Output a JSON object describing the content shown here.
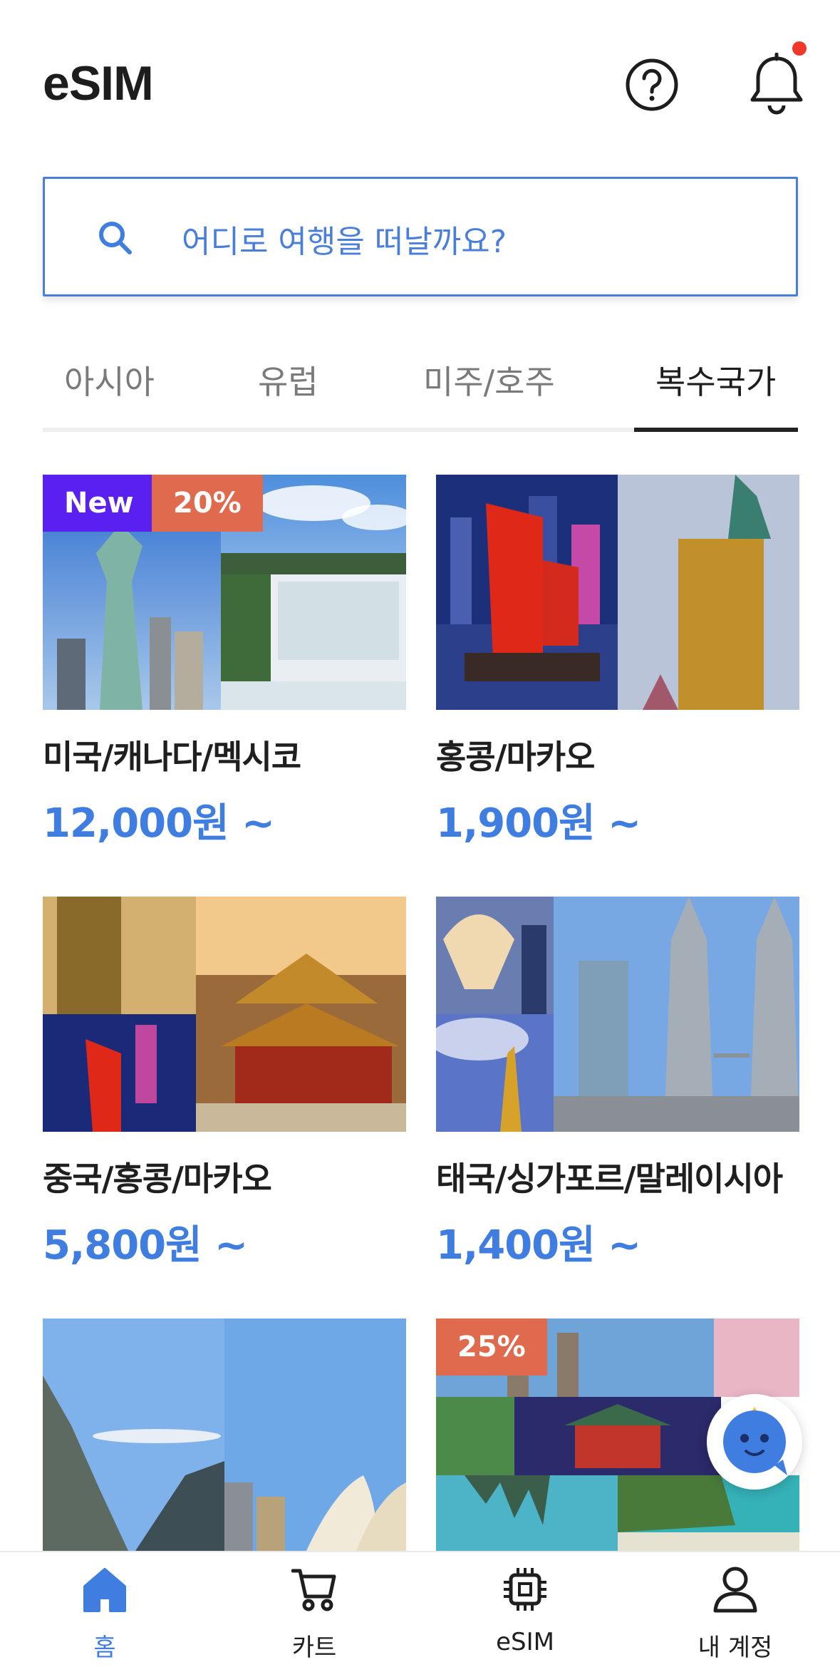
{
  "header": {
    "title": "eSIM"
  },
  "search": {
    "placeholder": "어디로 여행을 떠날까요?"
  },
  "tabs": [
    {
      "label": "아시아",
      "active": false
    },
    {
      "label": "유럽",
      "active": false
    },
    {
      "label": "미주/호주",
      "active": false
    },
    {
      "label": "복수국가",
      "active": true
    }
  ],
  "cards": [
    {
      "title": "미국/캐나다/멕시코",
      "price": "12,000원 ~",
      "badges": [
        "New",
        "20%"
      ]
    },
    {
      "title": "홍콩/마카오",
      "price": "1,900원 ~",
      "badges": []
    },
    {
      "title": "중국/홍콩/마카오",
      "price": "5,800원 ~",
      "badges": []
    },
    {
      "title": "태국/싱가포르/말레이시아",
      "price": "1,400원 ~",
      "badges": []
    },
    {
      "title": "",
      "price": "",
      "badges": []
    },
    {
      "title": "",
      "price": "",
      "badges": [
        "25%"
      ]
    }
  ],
  "bottom_nav": [
    {
      "label": "홈",
      "icon": "home-icon",
      "active": true
    },
    {
      "label": "카트",
      "icon": "cart-icon",
      "active": false
    },
    {
      "label": "eSIM",
      "icon": "chip-icon",
      "active": false
    },
    {
      "label": "내 계정",
      "icon": "user-icon",
      "active": false
    }
  ],
  "colors": {
    "accent": "#3f7ee0",
    "badge_new": "#5a20f0",
    "badge_sale": "#e06a4e",
    "notification": "#f0372a"
  }
}
